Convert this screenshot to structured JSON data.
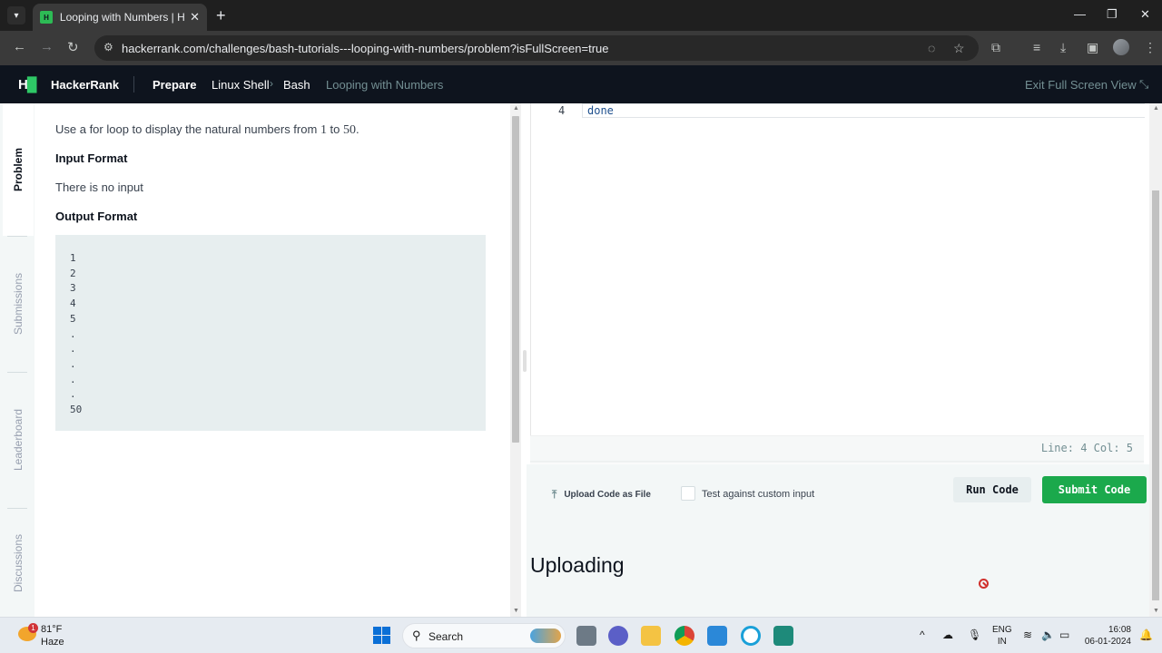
{
  "browser": {
    "tab_title": "Looping with Numbers | HackerRank",
    "url": "hackerrank.com/challenges/bash-tutorials---looping-with-numbers/problem?isFullScreen=true"
  },
  "header": {
    "logo_mark": "H",
    "brand": "HackerRank",
    "breadcrumb": [
      "Prepare",
      "Linux Shell",
      "Bash",
      "Looping with Numbers"
    ],
    "exit_fullscreen": "Exit Full Screen View"
  },
  "side_tabs": [
    "Problem",
    "Submissions",
    "Leaderboard",
    "Discussions"
  ],
  "problem": {
    "intro_prefix": "Use a for loop to display the natural numbers from ",
    "num_from": "1",
    "intro_mid": " to ",
    "num_to": "50",
    "intro_suffix": ".",
    "input_heading": "Input Format",
    "input_text": "There is no input",
    "output_heading": "Output Format",
    "output_sample": [
      "1",
      "2",
      "3",
      "4",
      "5",
      ".",
      ".",
      ".",
      ".",
      ".",
      "50"
    ]
  },
  "editor": {
    "line_number": "4",
    "line_code": "done",
    "status": "Line: 4 Col: 5"
  },
  "actions": {
    "upload_label": "Upload Code as File",
    "custom_input_label": "Test against custom input",
    "run_label": "Run Code",
    "submit_label": "Submit Code",
    "uploading_text": "Uploading"
  },
  "taskbar": {
    "weather_badge": "1",
    "weather_temp": "81°F",
    "weather_desc": "Haze",
    "search_label": "Search",
    "lang_line1": "ENG",
    "lang_line2": "IN",
    "time": "16:08",
    "date": "06-01-2024"
  },
  "colors": {
    "header_bg": "#0e141e",
    "brand_green": "#2ec866",
    "submit_green": "#1ba94c",
    "panel_bg": "#f3f7f7"
  }
}
